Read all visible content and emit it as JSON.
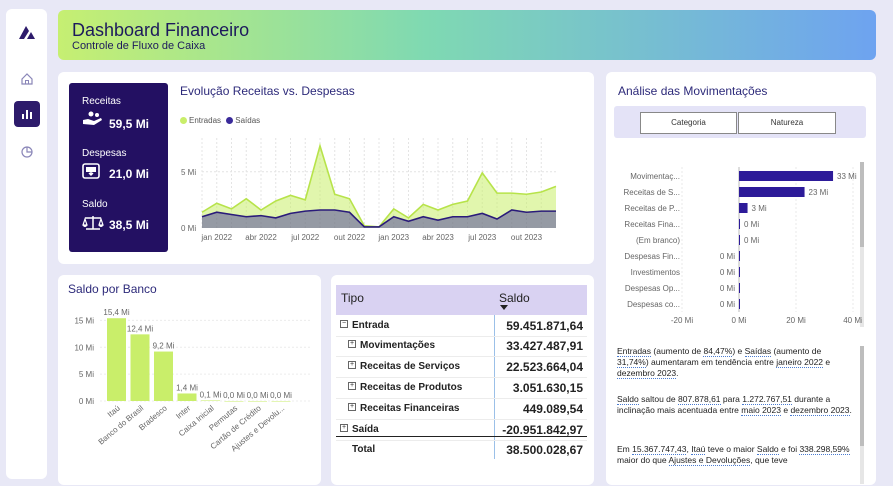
{
  "header": {
    "title": "Dashboard Financeiro",
    "subtitle": "Controle de Fluxo de Caixa"
  },
  "sidebar": {
    "items": [
      {
        "icon": "logo-icon"
      },
      {
        "icon": "home-icon"
      },
      {
        "icon": "bar-chart-icon",
        "active": true
      },
      {
        "icon": "pie-chart-icon"
      }
    ]
  },
  "kpi": {
    "receitas_label": "Receitas",
    "receitas_value": "59,5 Mi",
    "despesas_label": "Despesas",
    "despesas_value": "21,0 Mi",
    "saldo_label": "Saldo",
    "saldo_value": "38,5 Mi"
  },
  "colors": {
    "entradas": "#c9ee6a",
    "saidas": "#3a2a9a",
    "kpi_bg": "#231062",
    "bar_green": "#c9ee6a",
    "bar_purple": "#2d1b99"
  },
  "chart_data": [
    {
      "type": "area",
      "title": "Evolução Receitas vs. Despesas",
      "x": [
        "jan 2022",
        "fev 2022",
        "mar 2022",
        "abr 2022",
        "mai 2022",
        "jun 2022",
        "jul 2022",
        "ago 2022",
        "set 2022",
        "out 2022",
        "nov 2022",
        "dez 2022",
        "jan 2023",
        "fev 2023",
        "mar 2023",
        "abr 2023",
        "mai 2023",
        "jun 2023",
        "jul 2023",
        "ago 2023",
        "set 2023",
        "out 2023",
        "nov 2023",
        "dez 2023"
      ],
      "x_ticks": [
        "jan 2022",
        "abr 2022",
        "jul 2022",
        "out 2022",
        "jan 2023",
        "abr 2023",
        "jul 2023",
        "out 2023"
      ],
      "y_ticks": [
        "0 Mi",
        "5 Mi"
      ],
      "ylim": [
        0,
        8
      ],
      "series": [
        {
          "name": "Entradas",
          "values": [
            1.4,
            2.2,
            1.7,
            2.6,
            1.6,
            2.4,
            2.9,
            2.5,
            7.3,
            3.0,
            2.6,
            0.2,
            0.1,
            1.7,
            0.9,
            2.1,
            1.6,
            2.1,
            2.4,
            4.9,
            3.1,
            3.1,
            3.0,
            3.2,
            3.7
          ]
        },
        {
          "name": "Saídas",
          "values": [
            1.0,
            1.4,
            1.2,
            1.0,
            1.1,
            0.9,
            1.3,
            1.5,
            1.6,
            1.6,
            1.4,
            0.1,
            0.1,
            1.0,
            0.6,
            1.0,
            0.7,
            1.0,
            1.0,
            1.3,
            0.8,
            1.6,
            1.4,
            1.5,
            1.5
          ]
        }
      ],
      "legend": "top-left"
    },
    {
      "type": "bar",
      "title": "Saldo por Banco",
      "categories": [
        "Itaú",
        "Banco do Brasil",
        "Bradesco",
        "Inter",
        "Caixa Inicial",
        "Permutas",
        "Cartão de Crédito",
        "Ajustes e Devolu..."
      ],
      "values": [
        15.4,
        12.4,
        9.2,
        1.4,
        0.1,
        0.0,
        0.0,
        0.0
      ],
      "labels": [
        "15,4 Mi",
        "12,4 Mi",
        "9,2 Mi",
        "1,4 Mi",
        "0,1 Mi",
        "0,0 Mi",
        "0,0 Mi",
        "0,0 Mi"
      ],
      "y_ticks": [
        "0 Mi",
        "5 Mi",
        "10 Mi",
        "15 Mi"
      ],
      "ylim": [
        0,
        16
      ]
    },
    {
      "type": "bar",
      "orientation": "horizontal",
      "title": "Análise das Movimentações",
      "categories": [
        "Movimentaç...",
        "Receitas de S...",
        "Receitas de P...",
        "Receitas Fina...",
        "(Em branco)",
        "Despesas Fin...",
        "Investimentos",
        "Despesas Op...",
        "Despesas co..."
      ],
      "values": [
        33,
        23,
        3,
        0,
        0,
        0,
        0,
        0,
        0
      ],
      "labels": [
        "33 Mi",
        "23 Mi",
        "3 Mi",
        "0 Mi",
        "0 Mi",
        "0 Mi",
        "0 Mi",
        "0 Mi",
        "0 Mi"
      ],
      "x_ticks": [
        "-20 Mi",
        "0 Mi",
        "20 Mi",
        "40 Mi"
      ],
      "xlim": [
        -20,
        40
      ]
    }
  ],
  "bank": {
    "title": "Saldo por Banco"
  },
  "evolution": {
    "title": "Evolução Receitas vs. Despesas",
    "legend_entradas": "Entradas",
    "legend_saidas": "Saídas"
  },
  "table": {
    "col_tipo": "Tipo",
    "col_saldo": "Saldo",
    "rows": [
      {
        "label": "Entrada",
        "value": "59.451.871,64",
        "level": 0,
        "sign": "⊟"
      },
      {
        "label": "Movimentações",
        "value": "33.427.487,91",
        "level": 1,
        "sign": "⊞"
      },
      {
        "label": "Receitas de Serviços",
        "value": "22.523.664,04",
        "level": 1,
        "sign": "⊞"
      },
      {
        "label": "Receitas de Produtos",
        "value": "3.051.630,15",
        "level": 1,
        "sign": "⊞"
      },
      {
        "label": "Receitas Financeiras",
        "value": "449.089,54",
        "level": 1,
        "sign": "⊞"
      },
      {
        "label": "Saída",
        "value": "-20.951.842,97",
        "level": 0,
        "sign": "⊞"
      },
      {
        "label": "Total",
        "value": "38.500.028,67",
        "level": 0,
        "sign": ""
      }
    ]
  },
  "analysis": {
    "title": "Análise das Movimentações",
    "tab_categoria": "Categoria",
    "tab_natureza": "Natureza",
    "p1_a": "Entradas",
    "p1_b": " (aumento de ",
    "p1_c": "84,47%",
    "p1_d": ") e ",
    "p1_e": "Saídas",
    "p1_f": " (aumento de ",
    "p1_g": "31,74%",
    "p1_h": ") aumentaram em tendência entre ",
    "p1_i": "janeiro 2022",
    "p1_j": " e ",
    "p1_k": "dezembro 2023",
    "p1_l": ".",
    "p2_a": "Saldo",
    "p2_b": " saltou de ",
    "p2_c": "807.878,61",
    "p2_d": " para ",
    "p2_e": "1.272.767,51",
    "p2_f": " durante a inclinação mais acentuada entre ",
    "p2_g": "maio 2023",
    "p2_h": " e ",
    "p2_i": "dezembro 2023",
    "p2_j": ".",
    "p3_a": "Em ",
    "p3_b": "15.367.747,43",
    "p3_c": ", ",
    "p3_d": "Itaú",
    "p3_e": " teve o maior ",
    "p3_f": "Saldo",
    "p3_g": " e foi ",
    "p3_h": "338.298,59%",
    "p3_i": " maior do que ",
    "p3_j": "Ajustes e Devoluções",
    "p3_k": ", que teve"
  }
}
